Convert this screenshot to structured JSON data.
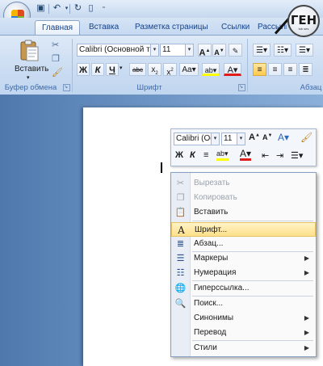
{
  "tabs": [
    "Главная",
    "Вставка",
    "Разметка страницы",
    "Ссылки",
    "Рассылки"
  ],
  "clipboard": {
    "paste_label": "Вставить",
    "group_label": "Буфер обмена"
  },
  "font": {
    "name": "Calibri (Основной те",
    "size": "11",
    "group_label": "Шрифт"
  },
  "paragraph": {
    "group_label": "Абзац"
  },
  "mini_toolbar": {
    "font": "Calibri (Ос",
    "size": "11"
  },
  "context_menu": [
    {
      "label": "Вырезать",
      "icon": "scissors-icon",
      "glyph": "✂",
      "disabled": true,
      "submenu": false
    },
    {
      "label": "Копировать",
      "icon": "copy-icon",
      "glyph": "❐",
      "disabled": true,
      "submenu": false
    },
    {
      "label": "Вставить",
      "icon": "paste-icon",
      "glyph": "📋",
      "disabled": false,
      "submenu": false
    },
    {
      "label": "Шрифт...",
      "icon": "font-icon",
      "glyph": "A",
      "disabled": false,
      "submenu": false,
      "highlighted": true
    },
    {
      "label": "Абзац...",
      "icon": "paragraph-icon",
      "glyph": "≣",
      "disabled": false,
      "submenu": false
    },
    {
      "label": "Маркеры",
      "icon": "bullets-icon",
      "glyph": "☰",
      "disabled": false,
      "submenu": true
    },
    {
      "label": "Нумерация",
      "icon": "numbering-icon",
      "glyph": "☷",
      "disabled": false,
      "submenu": true
    },
    {
      "label": "Гиперссылка...",
      "icon": "hyperlink-icon",
      "glyph": "🌐",
      "disabled": false,
      "submenu": false
    },
    {
      "label": "Поиск...",
      "icon": "research-icon",
      "glyph": "🔍",
      "disabled": false,
      "submenu": false
    },
    {
      "label": "Синонимы",
      "icon": "",
      "glyph": "",
      "disabled": false,
      "submenu": true
    },
    {
      "label": "Перевод",
      "icon": "",
      "glyph": "",
      "disabled": false,
      "submenu": true
    },
    {
      "label": "Стили",
      "icon": "",
      "glyph": "",
      "disabled": false,
      "submenu": true
    }
  ],
  "watermark": {
    "text": "ГЕН",
    "sub": "lab ses"
  },
  "colors": {
    "ribbon": "#cadcf2",
    "highlight": "#ffe08a",
    "document_bg": "#6b93c3"
  }
}
